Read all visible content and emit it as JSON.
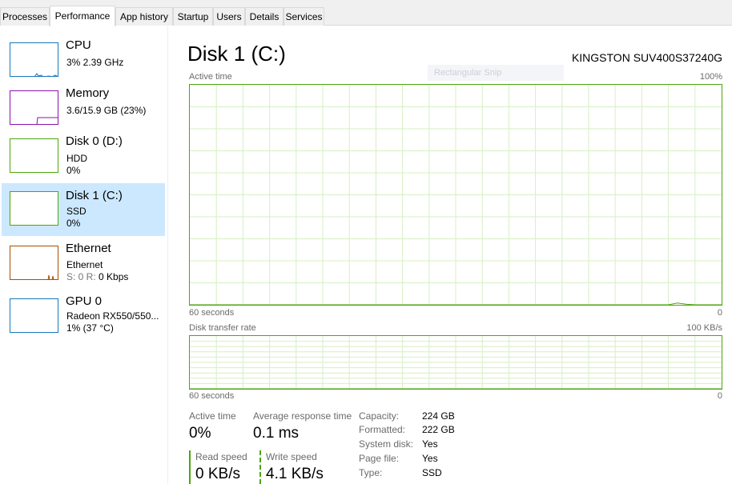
{
  "tabs": [
    {
      "label": "Processes"
    },
    {
      "label": "Performance"
    },
    {
      "label": "App history"
    },
    {
      "label": "Startup"
    },
    {
      "label": "Users"
    },
    {
      "label": "Details"
    },
    {
      "label": "Services"
    }
  ],
  "active_tab": "Performance",
  "sidebar": {
    "items": [
      {
        "title": "CPU",
        "line1": "3%  2.39 GHz",
        "line2": "",
        "color": "#1779ba"
      },
      {
        "title": "Memory",
        "line1": "3.6/15.9 GB (23%)",
        "line2": "",
        "color": "#8b12ae"
      },
      {
        "title": "Disk 0 (D:)",
        "line1": "HDD",
        "line2": "0%",
        "color": "#4da60c"
      },
      {
        "title": "Disk 1 (C:)",
        "line1": "SSD",
        "line2": "0%",
        "color": "#4da60c",
        "selected": true
      },
      {
        "title": "Ethernet",
        "line1": "Ethernet",
        "line2_prefix": "S: 0 R: ",
        "line2_value": "0 Kbps",
        "color": "#a74f01"
      },
      {
        "title": "GPU 0",
        "line1": "Radeon RX550/550...",
        "line2": "1%  (37 °C)",
        "color": "#1779ba"
      }
    ]
  },
  "main": {
    "title": "Disk 1 (C:)",
    "device": "KINGSTON SUV400S37240G",
    "snip_overlay": "Rectangular Snip",
    "active_time_graph": {
      "label": "Active time",
      "max_label": "100%",
      "time_label": "60 seconds",
      "min_label": "0"
    },
    "transfer_graph": {
      "label": "Disk transfer rate",
      "max_label": "100 KB/s",
      "time_label": "60 seconds",
      "min_label": "0"
    },
    "stats": {
      "active_time_label": "Active time",
      "active_time_value": "0%",
      "avg_response_label": "Average response time",
      "avg_response_value": "0.1 ms",
      "read_speed_label": "Read speed",
      "read_speed_value": "0 KB/s",
      "write_speed_label": "Write speed",
      "write_speed_value": "4.1 KB/s"
    },
    "properties": [
      {
        "key": "Capacity:",
        "value": "224 GB"
      },
      {
        "key": "Formatted:",
        "value": "222 GB"
      },
      {
        "key": "System disk:",
        "value": "Yes"
      },
      {
        "key": "Page file:",
        "value": "Yes"
      },
      {
        "key": "Type:",
        "value": "SSD"
      }
    ]
  },
  "colors": {
    "disk_green": "#4da60c",
    "selected_bg": "#cce8ff",
    "grid": "#d7efc4"
  },
  "chart_data": [
    {
      "type": "line",
      "title": "Active time",
      "ylim": [
        0,
        100
      ],
      "x_range_seconds": 60,
      "series": [
        {
          "values": [
            0,
            0,
            0,
            0,
            0,
            0,
            0,
            0,
            0,
            0,
            0,
            0,
            0,
            0,
            0,
            0,
            0,
            0,
            0,
            0,
            0,
            0,
            0,
            0,
            0,
            0,
            0,
            0,
            0,
            0,
            0,
            0,
            0,
            0,
            0,
            0,
            0,
            0,
            0,
            0,
            0,
            0,
            0,
            0,
            0,
            0,
            0,
            0,
            0,
            0,
            0,
            0,
            0,
            0,
            0,
            0.8,
            0.3,
            0,
            0,
            0,
            0
          ]
        }
      ]
    },
    {
      "type": "line",
      "title": "Disk transfer rate",
      "ylim": [
        0,
        100
      ],
      "x_range_seconds": 60,
      "series": [
        {
          "values": [
            0,
            0,
            0,
            0,
            0,
            0,
            0,
            0,
            0,
            0,
            0,
            0,
            0,
            0,
            0,
            0,
            0,
            0,
            0,
            0,
            0,
            0,
            0,
            0,
            0,
            0,
            0,
            0,
            0,
            0,
            0,
            0,
            0,
            0,
            0,
            0,
            0,
            0,
            0,
            0,
            0,
            0,
            0,
            0,
            0,
            0,
            0,
            0,
            0,
            0,
            0,
            0,
            0,
            0,
            0,
            0,
            0,
            0,
            0,
            0,
            0
          ]
        }
      ]
    }
  ]
}
